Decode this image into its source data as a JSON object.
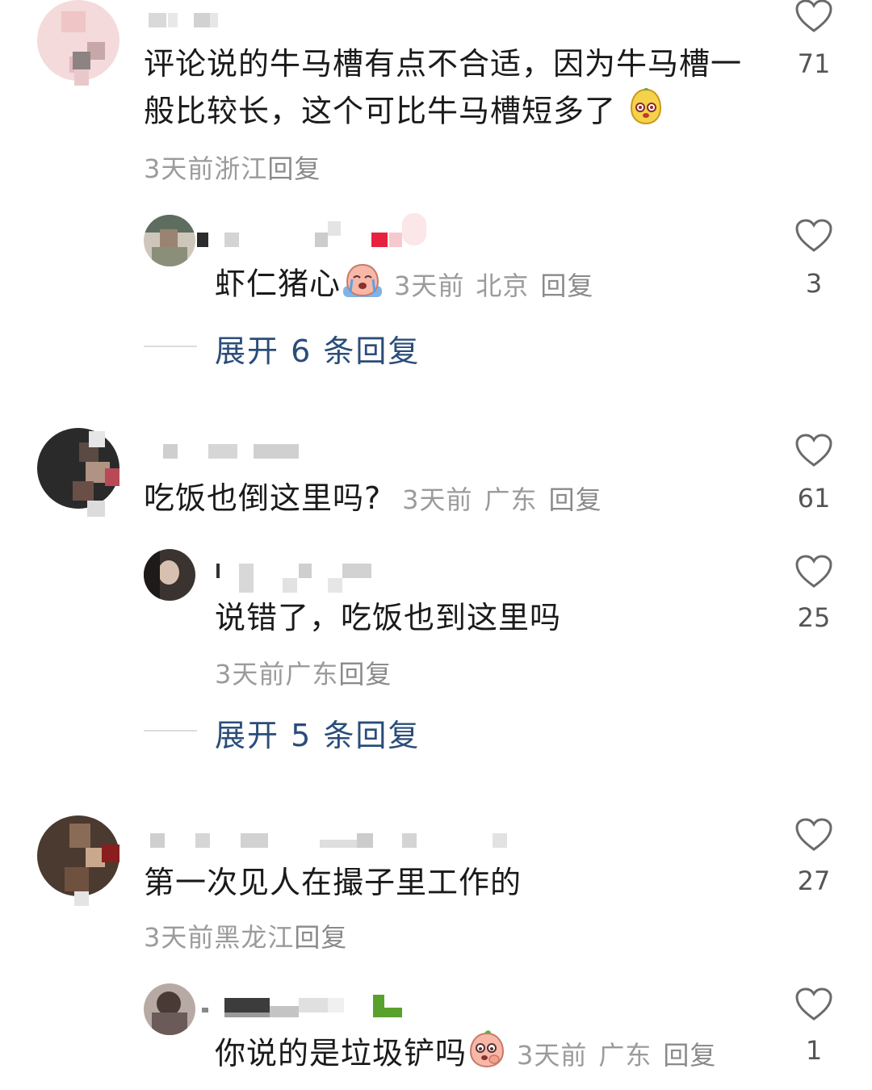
{
  "comments": [
    {
      "text_l1": "评论说的牛马槽有点不合适，因为牛马槽一",
      "text_l2": "般比较长，这个可比牛马槽短多了",
      "time": "3天前",
      "location": "浙江",
      "reply": "回复",
      "likes": "71",
      "sub": {
        "text": "虾仁猪心",
        "time": "3天前",
        "location": "北京",
        "reply": "回复",
        "likes": "3",
        "expand": "展开 6 条回复"
      }
    },
    {
      "text": "吃饭也倒这里吗?",
      "time": "3天前",
      "location": "广东",
      "reply": "回复",
      "likes": "61",
      "sub": {
        "text": "说错了，吃饭也到这里吗",
        "time": "3天前",
        "location": "广东",
        "reply": "回复",
        "likes": "25",
        "expand": "展开 5 条回复"
      }
    },
    {
      "text": "第一次见人在撮子里工作的",
      "time": "3天前",
      "location": "黑龙江",
      "reply": "回复",
      "likes": "27",
      "sub": {
        "text": "你说的是垃圾铲吗",
        "time": "3天前",
        "location": "广东",
        "reply": "回复",
        "likes": "1"
      }
    }
  ],
  "icons": {
    "like": "heart-outline-icon"
  },
  "colors": {
    "expand_link": "#2a4d7a",
    "meta": "#9b9b9b",
    "text": "#1a1a1a"
  }
}
